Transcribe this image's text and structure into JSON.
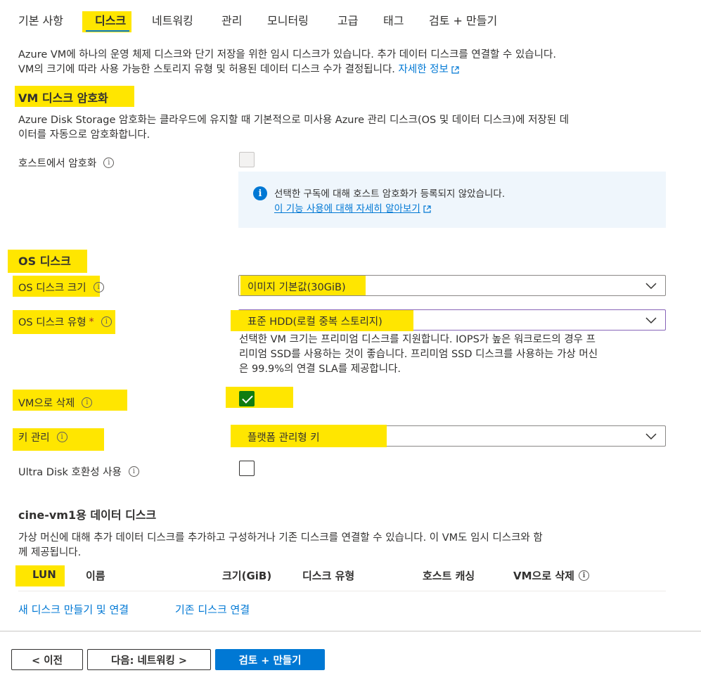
{
  "tabs": [
    "기본 사항",
    "디스크",
    "네트워킹",
    "관리",
    "모니터링",
    "고급",
    "태그",
    "검토 + 만들기"
  ],
  "active_tab": "디스크",
  "intro": {
    "line1": "Azure VM에 하나의 운영 체제 디스크와 단기 저장을 위한 임시 디스크가 있습니다. 추가 데이터 디스크를 연결할 수 있습니다.",
    "line2": "VM의 크기에 따라 사용 가능한 스토리지 유형 및 허용된 데이터 디스크 수가 결정됩니다.",
    "link": "자세한 정보"
  },
  "encryption": {
    "title": "VM 디스크 암호화",
    "desc_line1": "Azure Disk Storage 암호화는 클라우드에 유지할 때 기본적으로 미사용 Azure 관리 디스크(OS 및 데이터 디스크)에 저장된 데",
    "desc_line2": "이터를 자동으로 암호화합니다.",
    "host_label": "호스트에서 암호화",
    "host_checked": false,
    "info_text": "선택한 구독에 대해 호스트 암호화가 등록되지 않았습니다.",
    "info_link": "이 기능 사용에 대해 자세히 알아보기"
  },
  "os_disk": {
    "title": "OS 디스크",
    "size_label": "OS 디스크 크기",
    "size_value": "이미지 기본값(30GiB)",
    "type_label": "OS 디스크 유형",
    "required_mark": "*",
    "type_value": "표준 HDD(로컬 중복 스토리지)",
    "type_help_line1": "선택한 VM 크기는 프리미엄 디스크를 지원합니다. IOPS가 높은 워크로드의 경우 프",
    "type_help_line2": "리미엄 SSD를 사용하는 것이 좋습니다. 프리미엄 SSD 디스크를 사용하는 가상 머신",
    "type_help_line3": "은 99.9%의 연결 SLA를 제공합니다.",
    "delete_label": "VM으로 삭제",
    "delete_checked": true,
    "key_label": "키 관리",
    "key_value": "플랫폼 관리형 키",
    "ultra_label": "Ultra Disk 호환성 사용",
    "ultra_checked": false
  },
  "data_disks": {
    "title": "cine-vm1용 데이터 디스크",
    "desc_line1": "가상 머신에 대해 추가 데이터 디스크를 추가하고 구성하거나 기존 디스크를 연결할 수 있습니다. 이 VM도 임시 디스크와 함",
    "desc_line2": "께 제공됩니다.",
    "columns": [
      "LUN",
      "이름",
      "크기(GiB)",
      "디스크 유형",
      "호스트 캐싱",
      "VM으로 삭제"
    ],
    "create_link": "새 디스크 만들기 및 연결",
    "attach_link": "기존 디스크 연결"
  },
  "footer": {
    "prev": "< 이전",
    "next": "다음: 네트워킹 >",
    "review": "검토 + 만들기"
  },
  "colors": {
    "highlight": "#ffe600",
    "accent": "#0078d4",
    "checked": "#107c10"
  }
}
